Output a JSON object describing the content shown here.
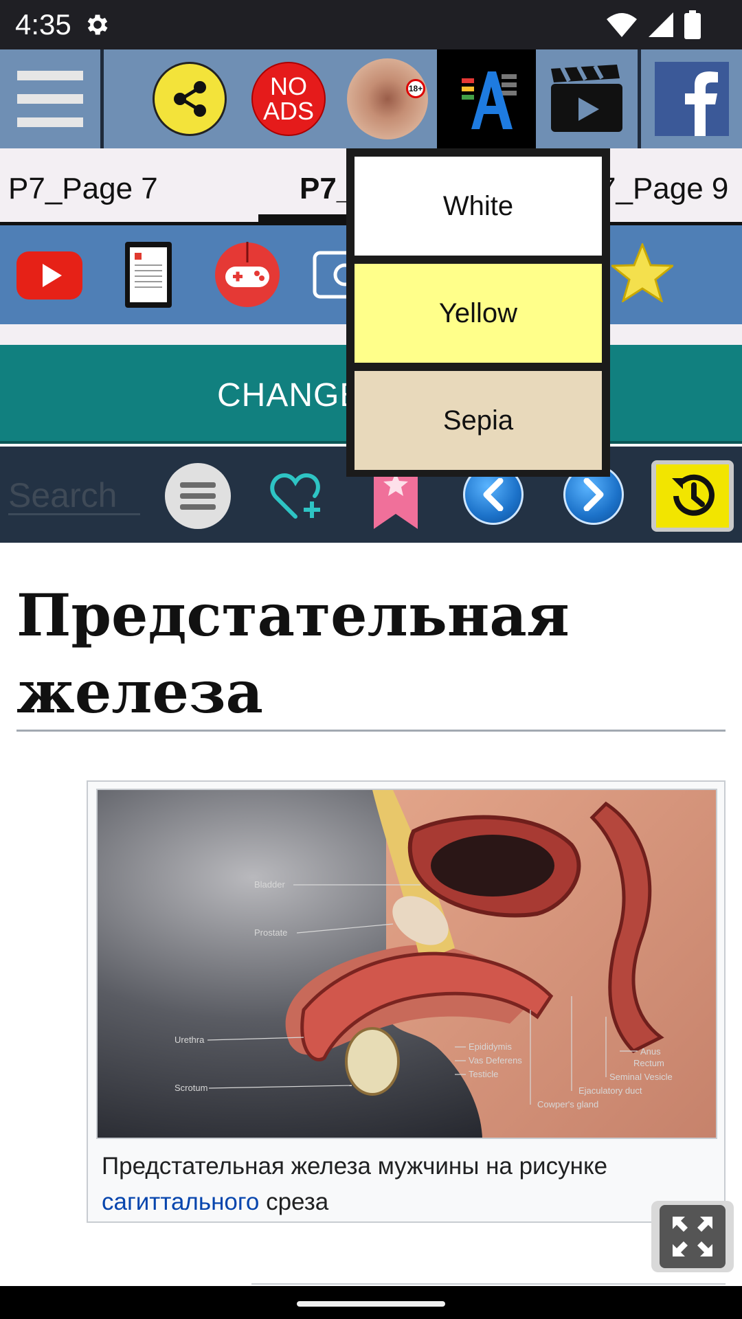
{
  "status_bar": {
    "time": "4:35"
  },
  "toolbar": {
    "no_ads_line1": "NO",
    "no_ads_line2": "ADS",
    "anatomy_badge": "18+"
  },
  "tabs": [
    {
      "label": "P7_Page 7"
    },
    {
      "label": "P7_"
    },
    {
      "label": "7_Page 9"
    }
  ],
  "change_button": {
    "label": "CHANGE"
  },
  "search": {
    "placeholder": "Search"
  },
  "colors": {
    "toolbar": "#6f8fb4",
    "icon_row": "#4f7fb6",
    "change_bar": "#11807f",
    "search_row": "#233244",
    "option_white": "#ffffff",
    "option_yellow": "#ffff8a",
    "option_sepia": "#e8d9bb"
  },
  "color_menu": {
    "options": [
      {
        "label": "White"
      },
      {
        "label": "Yellow"
      },
      {
        "label": "Sepia"
      }
    ]
  },
  "article": {
    "title": "Предстательная железа",
    "figure": {
      "labels": {
        "bladder": "Bladder",
        "prostate": "Prostate",
        "urethra": "Urethra",
        "scrotum": "Scrotum",
        "epididymis": "Epididymis",
        "vas_deferens": "Vas Deferens",
        "testicle": "Testicle",
        "anus": "Anus",
        "rectum": "Rectum",
        "seminal_vesicle": "Seminal Vesicle",
        "ejaculatory_duct": "Ejaculatory duct",
        "cowpers_gland": "Cowper's gland"
      },
      "caption_before": "Предстательная железа мужчины на рисунке ",
      "caption_link": "сагиттального",
      "caption_after": " среза"
    }
  },
  "icons": {
    "menu": "hamburger-menu-icon",
    "share": "share-icon",
    "no_ads": "no-ads-icon",
    "anatomy": "anatomy-app-icon",
    "font": "font-size-icon",
    "video": "video-clapper-icon",
    "facebook": "facebook-icon",
    "youtube": "youtube-icon",
    "ebook": "ebook-reader-icon",
    "gamepad": "gamepad-icon",
    "camera": "camera-icon",
    "star": "star-icon",
    "list": "list-icon",
    "heart_add": "heart-add-icon",
    "bookmark": "bookmark-icon",
    "back": "chevron-left-icon",
    "forward": "chevron-right-icon",
    "history": "history-icon",
    "expand": "expand-icon"
  }
}
